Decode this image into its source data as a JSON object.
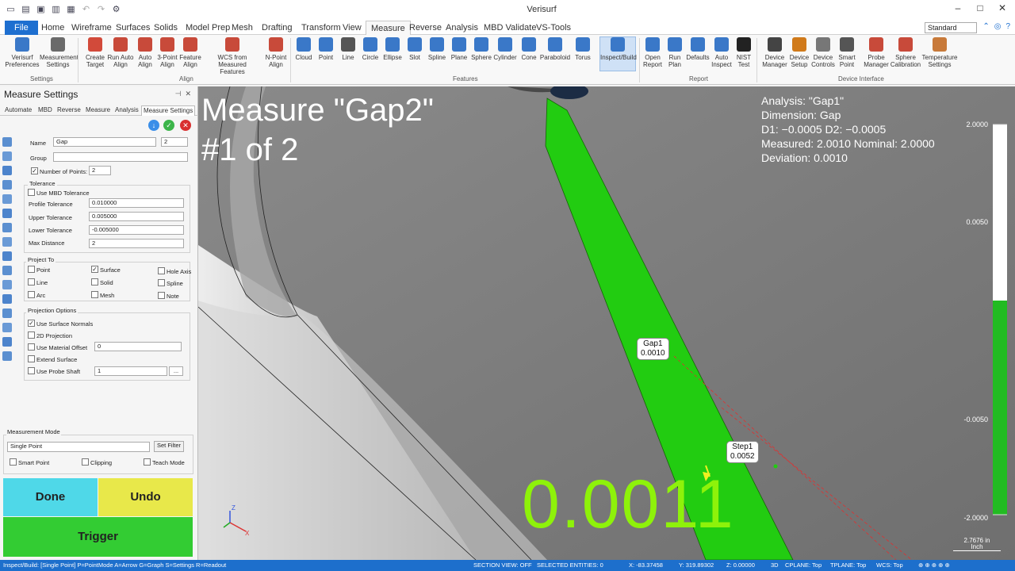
{
  "app": {
    "title": "Verisurf"
  },
  "quick_access": [
    "new-icon",
    "save-icon",
    "save-as-icon",
    "print-icon",
    "print-preview-icon",
    "undo-icon",
    "redo-icon",
    "gear-icon"
  ],
  "tabs": [
    "File",
    "Home",
    "Wireframe",
    "Surfaces",
    "Solids",
    "Model Prep",
    "Mesh",
    "Drafting",
    "Transform",
    "View",
    "Measure",
    "Reverse",
    "Analysis",
    "MBD Validate",
    "VS-Tools"
  ],
  "active_tab": "Measure",
  "style_select": "Standard",
  "ribbon": {
    "groups": [
      "Settings",
      "Align",
      "Features",
      "Report",
      "Device Interface"
    ],
    "buttons": [
      {
        "line1": "Verisurf",
        "line2": "Preferences",
        "icon": "preferences-icon"
      },
      {
        "line1": "Measurement",
        "line2": "Settings",
        "icon": "measurement-settings-icon"
      },
      {
        "line1": "Create",
        "line2": "Target",
        "icon": "target-icon"
      },
      {
        "line1": "Run Auto",
        "line2": "Align",
        "icon": "auto-align-run-icon"
      },
      {
        "line1": "Auto",
        "line2": "Align",
        "icon": "auto-align-icon"
      },
      {
        "line1": "3-Point",
        "line2": "Align",
        "icon": "three-point-align-icon"
      },
      {
        "line1": "Feature",
        "line2": "Align",
        "icon": "feature-align-icon"
      },
      {
        "line1": "WCS from",
        "line2": "Measured Features",
        "icon": "wcs-icon"
      },
      {
        "line1": "N-Point",
        "line2": "Align",
        "icon": "n-point-align-icon"
      },
      {
        "line1": "Cloud",
        "line2": "",
        "icon": "cloud-icon"
      },
      {
        "line1": "Point",
        "line2": "",
        "icon": "point-icon"
      },
      {
        "line1": "Line",
        "line2": "",
        "icon": "line-icon"
      },
      {
        "line1": "Circle",
        "line2": "",
        "icon": "circle-icon"
      },
      {
        "line1": "Ellipse",
        "line2": "",
        "icon": "ellipse-icon"
      },
      {
        "line1": "Slot",
        "line2": "",
        "icon": "slot-icon"
      },
      {
        "line1": "Spline",
        "line2": "",
        "icon": "spline-icon"
      },
      {
        "line1": "Plane",
        "line2": "",
        "icon": "plane-icon"
      },
      {
        "line1": "Sphere",
        "line2": "",
        "icon": "sphere-icon"
      },
      {
        "line1": "Cylinder",
        "line2": "",
        "icon": "cylinder-icon"
      },
      {
        "line1": "Cone",
        "line2": "",
        "icon": "cone-icon"
      },
      {
        "line1": "Paraboloid",
        "line2": "",
        "icon": "paraboloid-icon"
      },
      {
        "line1": "Torus",
        "line2": "",
        "icon": "torus-icon"
      },
      {
        "line1": "Inspect/Build",
        "line2": "",
        "icon": "inspect-build-icon"
      },
      {
        "line1": "Open",
        "line2": "Report",
        "icon": "open-report-icon"
      },
      {
        "line1": "Run",
        "line2": "Plan",
        "icon": "run-plan-icon"
      },
      {
        "line1": "Defaults",
        "line2": "",
        "icon": "defaults-icon"
      },
      {
        "line1": "Auto",
        "line2": "Inspect",
        "icon": "auto-inspect-icon"
      },
      {
        "line1": "NIST",
        "line2": "Test",
        "icon": "nist-icon"
      },
      {
        "line1": "Device",
        "line2": "Manager",
        "icon": "device-manager-icon"
      },
      {
        "line1": "Device",
        "line2": "Setup",
        "icon": "device-setup-icon"
      },
      {
        "line1": "Device",
        "line2": "Controls",
        "icon": "device-controls-icon"
      },
      {
        "line1": "Smart",
        "line2": "Point",
        "icon": "smart-point-icon"
      },
      {
        "line1": "Probe",
        "line2": "Manager",
        "icon": "probe-manager-icon"
      },
      {
        "line1": "Sphere",
        "line2": "Calibration",
        "icon": "sphere-calibration-icon"
      },
      {
        "line1": "Temperature",
        "line2": "Settings",
        "icon": "temperature-icon"
      }
    ]
  },
  "panel": {
    "title": "Measure Settings",
    "tabs": [
      "Automate",
      "MBD",
      "Reverse",
      "Measure",
      "Analysis",
      "Measure Settings"
    ],
    "name_label": "Name",
    "name_value": "Gap",
    "name_index": "2",
    "group_label": "Group",
    "num_points_label": "Number of Points:",
    "num_points_value": "2",
    "tolerance": {
      "heading": "Tolerance",
      "use_mbd": "Use MBD Tolerance",
      "profile_label": "Profile Tolerance",
      "profile_value": "0.010000",
      "upper_label": "Upper Tolerance",
      "upper_value": "0.005000",
      "lower_label": "Lower Tolerance",
      "lower_value": "-0.005000",
      "max_label": "Max Distance",
      "max_value": "2"
    },
    "project_to": {
      "heading": "Project To",
      "options": [
        "Point",
        "Surface",
        "Hole Axis",
        "Line",
        "Solid",
        "Spline",
        "Arc",
        "Mesh",
        "Note"
      ]
    },
    "projection": {
      "heading": "Projection Options",
      "surface_normals": "Use Surface Normals",
      "projection_2d": "2D Projection",
      "material_offset": "Use Material Offset",
      "material_offset_value": "0",
      "extend_surface": "Extend Surface",
      "probe_shaft": "Use Probe Shaft",
      "probe_shaft_value": "1",
      "browse": "..."
    },
    "mode": {
      "heading": "Measurement Mode",
      "value": "Single Point",
      "set_filter": "Set Filter",
      "smart_point": "Smart Point",
      "clipping": "Clipping",
      "teach_mode": "Teach Mode"
    },
    "done": "Done",
    "undo": "Undo",
    "trigger": "Trigger"
  },
  "viewport": {
    "title_line1": "Measure \"Gap2\"",
    "title_line2": "#1 of 2",
    "analysis": {
      "line1": "Analysis: \"Gap1\"",
      "line2": "Dimension: Gap",
      "line3": "D1: −0.0005 D2: −0.0005",
      "line4": "Measured: 2.0010 Nominal: 2.0000",
      "line5": "Deviation: 0.0010"
    },
    "gap_tag": {
      "name": "Gap1",
      "value": "0.0010"
    },
    "step_tag": {
      "name": "Step1",
      "value": "0.0052"
    },
    "readout": "0.0011",
    "scale": {
      "top": "2.0000",
      "upper": "0.0050",
      "lower": "-0.0050",
      "bottom": "-2.0000"
    },
    "units_value": "2.7676 in",
    "units_label": "Inch",
    "colors": {
      "part": "#22cc11",
      "readout": "#8ef20a",
      "scale_green": "#22bb22"
    }
  },
  "status": {
    "mode": "Inspect/Build: [Single Point]  P=PointMode  A=Arrow  G=Graph  S=Settings  R=Readout",
    "section_view": "SECTION VIEW: OFF",
    "selected": "SELECTED ENTITIES: 0",
    "x": "X:  -83.37458",
    "y": "Y:  319.89302",
    "z": "Z:  0.00000",
    "view": "3D",
    "cplane": "CPLANE: Top",
    "tplane": "TPLANE: Top",
    "wcs": "WCS: Top"
  }
}
